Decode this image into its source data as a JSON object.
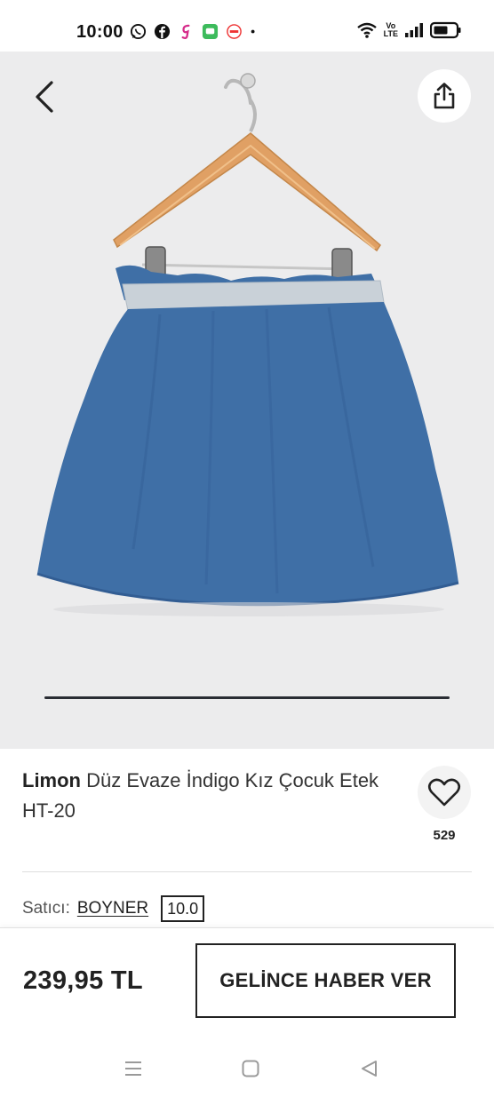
{
  "status_bar": {
    "time": "10:00",
    "left_icons": [
      "whatsapp-icon",
      "facebook-icon",
      "app-g-icon",
      "messages-icon",
      "app-badge-icon",
      "dot-icon"
    ],
    "right_icons": [
      "wifi-icon",
      "volte-icon",
      "signal-icon",
      "battery-icon"
    ],
    "volte_line1": "Vo",
    "volte_line2": "LTE"
  },
  "product": {
    "brand": "Limon",
    "name": "Düz Evaze İndigo Kız Çocuk Etek  HT-20",
    "favorite_count": "529",
    "seller_label": "Satıcı:",
    "seller_name": "BOYNER",
    "seller_score": "10.0"
  },
  "purchase_bar": {
    "price": "239,95 TL",
    "notify_label": "GELİNCE HABER VER"
  },
  "colors": {
    "image_background": "#ececed",
    "denim": "#3f6fa6",
    "hanger_wood": "#e0a064",
    "text_primary": "#222222"
  },
  "icons": {
    "back": "chevron-left-icon",
    "share": "share-icon",
    "favorite": "heart-icon",
    "nav_menu": "recent-apps-icon",
    "nav_home": "home-icon",
    "nav_back": "back-triangle-icon"
  }
}
